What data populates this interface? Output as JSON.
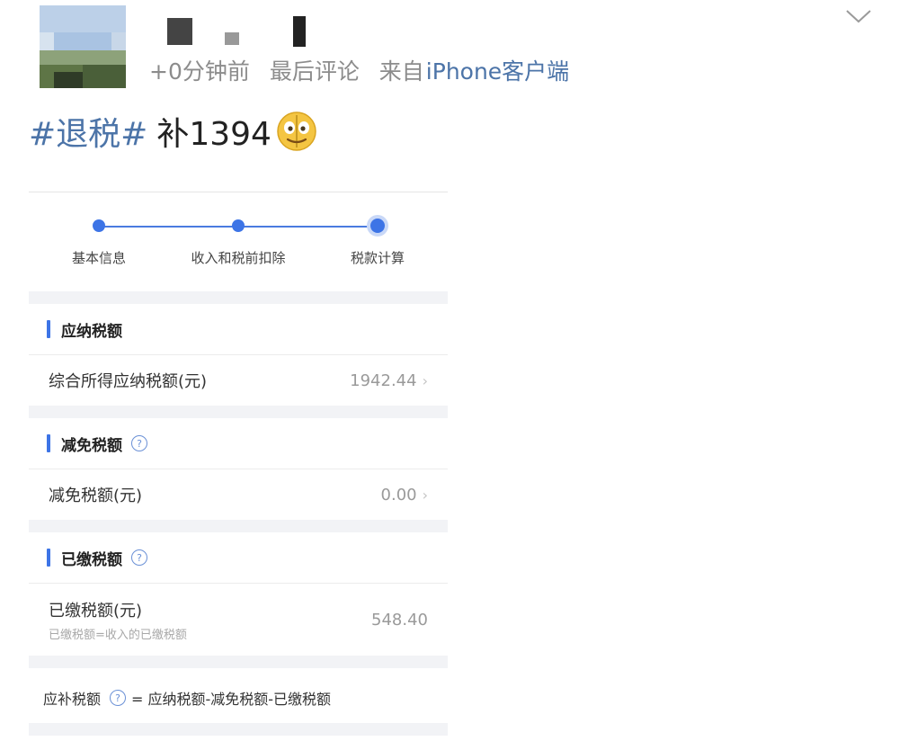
{
  "post": {
    "meta": {
      "time": "+0分钟前",
      "edited": "最后评论",
      "source_prefix": "来自",
      "source_name": "iPhone客户端"
    },
    "text": {
      "hashtag": "#退税#",
      "body": "补1394"
    },
    "emoji": "face-emoji"
  },
  "screenshot": {
    "steps": [
      {
        "label": "基本信息"
      },
      {
        "label": "收入和税前扣除"
      },
      {
        "label": "税款计算"
      }
    ],
    "sections": {
      "payable": {
        "title": "应纳税额",
        "row_label": "综合所得应纳税额(元)",
        "row_value": "1942.44"
      },
      "reduction": {
        "title": "减免税额",
        "row_label": "减免税额(元)",
        "row_value": "0.00"
      },
      "paid": {
        "title": "已缴税额",
        "row_label": "已缴税额(元)",
        "row_sub": "已缴税额=收入的已缴税额",
        "row_value": "548.40"
      }
    },
    "formula": {
      "label": "应补税额",
      "expr": "= 应纳税额-减免税额-已缴税额"
    }
  },
  "colors": {
    "accent": "#3d74e6",
    "link": "#4c74a8",
    "gap": "#f2f3f6"
  }
}
